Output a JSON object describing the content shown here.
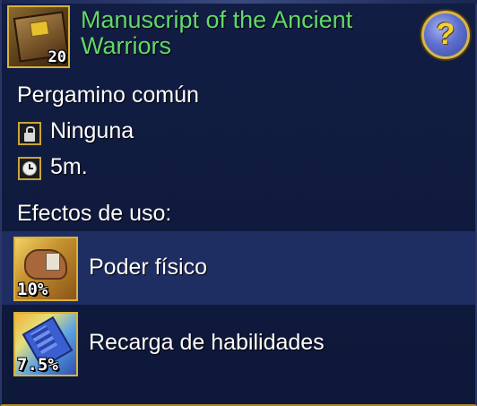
{
  "item": {
    "name": "Manuscript of the Ancient Warriors",
    "stack_count": "20",
    "icon": "ancient-book-icon",
    "title_color": "#63d86a"
  },
  "help_button": {
    "symbol": "?",
    "icon": "question-mark-icon"
  },
  "details": {
    "type": "Pergamino común",
    "binding": "Ninguna",
    "binding_icon": "lock-icon",
    "duration": "5m.",
    "duration_icon": "clock-icon"
  },
  "effects": {
    "heading": "Efectos de uso:",
    "items": [
      {
        "label": "Poder físico",
        "value": "10%",
        "icon": "flexed-arm-icon",
        "highlighted": true
      },
      {
        "label": "Recarga de habilidades",
        "value": "7.5%",
        "icon": "skill-cooldown-icon",
        "highlighted": false
      }
    ]
  },
  "colors": {
    "panel_bg": "#0f1a3d",
    "highlight_row": "#1e2d62",
    "gold_border": "#d8b23a"
  }
}
